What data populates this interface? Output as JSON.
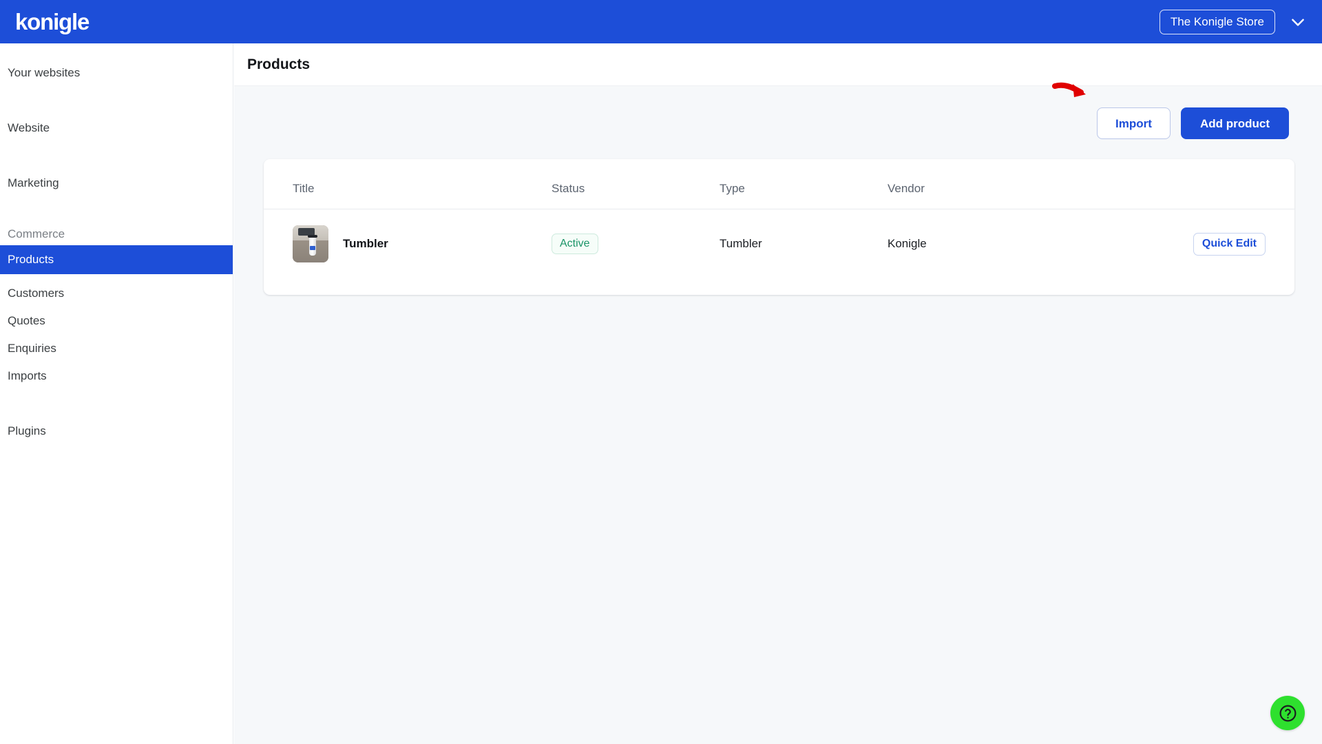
{
  "topbar": {
    "logo_text": "konigle",
    "store_name": "The Konigle Store",
    "chevron_icon": "chevron-down-icon",
    "background_color": "#1d4ed8"
  },
  "sidebar": {
    "items": [
      {
        "label": "Your websites",
        "type": "link",
        "active": false
      },
      {
        "label": "Website",
        "type": "link",
        "active": false
      },
      {
        "label": "Marketing",
        "type": "link",
        "active": false
      },
      {
        "label": "Commerce",
        "type": "section",
        "active": false
      },
      {
        "label": "Products",
        "type": "link",
        "active": true
      },
      {
        "label": "Customers",
        "type": "link",
        "active": false
      },
      {
        "label": "Quotes",
        "type": "link",
        "active": false
      },
      {
        "label": "Enquiries",
        "type": "link",
        "active": false
      },
      {
        "label": "Imports",
        "type": "link",
        "active": false
      },
      {
        "label": "Plugins",
        "type": "link",
        "active": false
      }
    ],
    "active_color": "#1d4ed8"
  },
  "page": {
    "title": "Products"
  },
  "toolbar": {
    "import_label": "Import",
    "add_product_label": "Add product",
    "annotation_icon": "red-arrow-icon",
    "annotation_color": "#e00000",
    "annotation_target": "Import"
  },
  "table": {
    "columns": [
      "Title",
      "Status",
      "Type",
      "Vendor",
      ""
    ],
    "rows": [
      {
        "thumbnail": "product-thumbnail-tumbler",
        "title": "Tumbler",
        "status": "Active",
        "status_color": "#1a9467",
        "type": "Tumbler",
        "vendor": "Konigle",
        "action_label": "Quick Edit"
      }
    ]
  },
  "help": {
    "icon": "question-mark-icon",
    "color": "#2ee02e"
  }
}
